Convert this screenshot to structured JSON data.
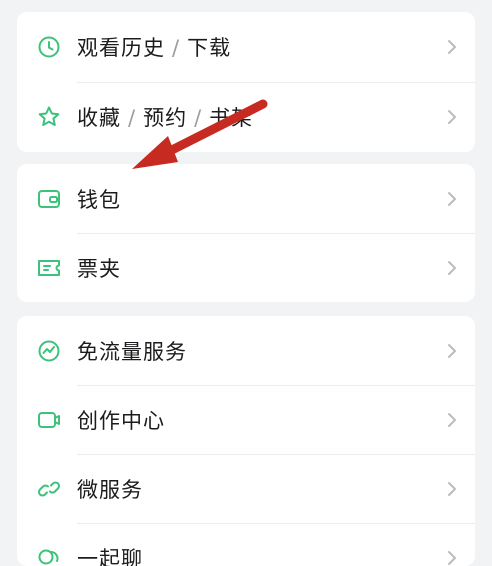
{
  "colors": {
    "background": "#f2f3f5",
    "card": "#ffffff",
    "icon_green": "#3cc27a",
    "text": "#1c1c1e",
    "separator_text": "#9a9da3",
    "chevron": "#b9bcc1",
    "annotation_arrow": "#c62a21"
  },
  "group1": {
    "items": [
      {
        "icon": "clock-icon",
        "parts": [
          "观看历史",
          "下载"
        ]
      },
      {
        "icon": "star-icon",
        "parts": [
          "收藏",
          "预约",
          "书架"
        ]
      }
    ]
  },
  "group2": {
    "items": [
      {
        "icon": "wallet-icon",
        "label": "钱包"
      },
      {
        "icon": "ticket-icon",
        "label": "票夹"
      }
    ]
  },
  "group3": {
    "items": [
      {
        "icon": "traffic-icon",
        "label": "免流量服务"
      },
      {
        "icon": "video-camera-icon",
        "label": "创作中心"
      },
      {
        "icon": "link-icon",
        "label": "微服务"
      },
      {
        "icon": "chat-icon",
        "label": "一起聊"
      }
    ]
  },
  "separator": "/",
  "annotation": {
    "icon": "red-arrow-icon",
    "points_to": "钱包"
  }
}
